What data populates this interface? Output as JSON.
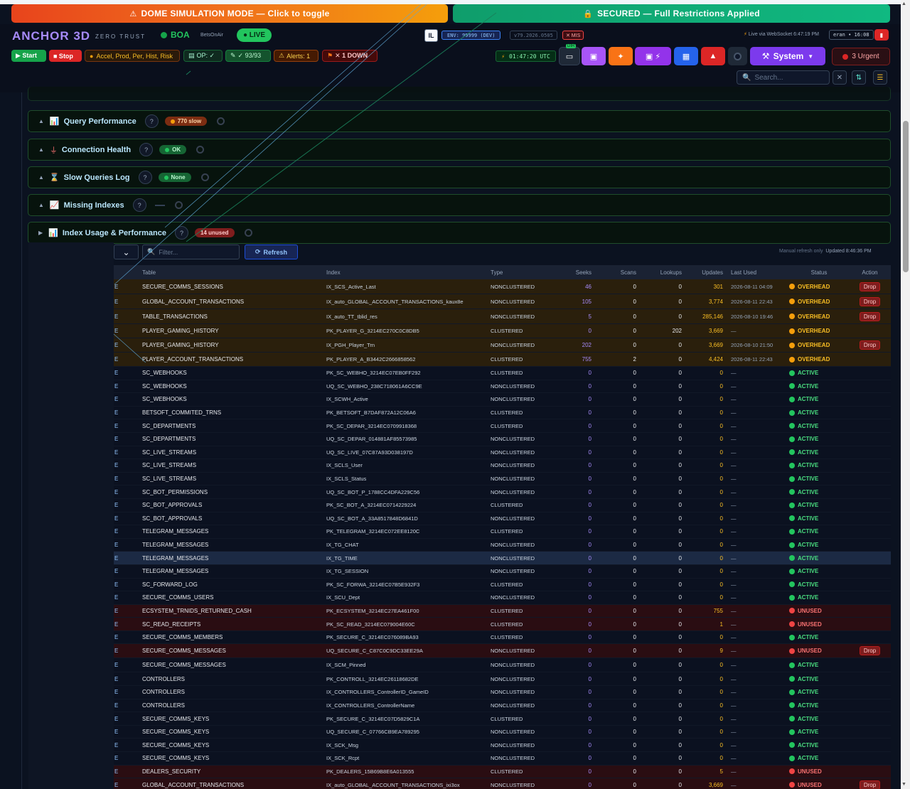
{
  "banners": {
    "simulation": "DOME SIMULATION MODE — Click to toggle",
    "secured": "SECURED — Full Restrictions Applied"
  },
  "header": {
    "brand": "ANCHOR 3D",
    "brand_sub": "ZERO TRUST",
    "boa": "BOA",
    "betsonair": "BetsOnAir",
    "live": "● LIVE",
    "il": "IL",
    "env": "ENV: 99999 (DEV)",
    "version": "v79.2026.0505",
    "mis": "✕ MIS",
    "live_ws": "Live via WebSocket 6:47:19 PM",
    "user": "eran • 16:08",
    "start": "▶ Start",
    "stop": "■ Stop",
    "accel": "Accel, Prod, Per, Hist, Risk",
    "op": "OP: ✓",
    "count": "✓ 93/93",
    "alerts": "Alerts: 1",
    "down": "✕ 1 DOWN",
    "clock": "01:47:20 UTC",
    "dir_label": "DIR",
    "system": "System",
    "urgent": "3 Urgent",
    "search_placeholder": "Search..."
  },
  "sections": [
    {
      "title": "Query Performance",
      "badge": "770 slow",
      "badge_type": "slow"
    },
    {
      "title": "Connection Health",
      "badge": "OK",
      "badge_type": "ok"
    },
    {
      "title": "Slow Queries Log",
      "badge": "None",
      "badge_type": "ok"
    },
    {
      "title": "Missing Indexes",
      "badge": "",
      "badge_type": "none"
    },
    {
      "title": "Index Usage & Performance",
      "badge": "14 unused",
      "badge_type": "unused"
    }
  ],
  "toolbar": {
    "filter_placeholder": "Filter...",
    "refresh": "Refresh",
    "note": "Manual refresh only",
    "updated": "Updated 8:46:36 PM"
  },
  "table": {
    "headers": [
      "Table",
      "Index",
      "Type",
      "Seeks",
      "Scans",
      "Lookups",
      "Updates",
      "Last Used",
      "Status",
      "Action"
    ],
    "drop_label": "Drop",
    "rows": [
      {
        "t": "SECURE_COMMS_SESSIONS",
        "i": "IX_SCS_Active_Last",
        "ty": "NONCLUSTERED",
        "sk": "46",
        "sc": "0",
        "lk": "0",
        "up": "301",
        "lu": "2026-08-11 04:09",
        "st": "OVERHEAD",
        "drop": true
      },
      {
        "t": "GLOBAL_ACCOUNT_TRANSACTIONS",
        "i": "IX_auto_GLOBAL_ACCOUNT_TRANSACTIONS_kaux8e",
        "ty": "NONCLUSTERED",
        "sk": "105",
        "sc": "0",
        "lk": "0",
        "up": "3,774",
        "lu": "2026-08-11 22:43",
        "st": "OVERHEAD",
        "drop": true
      },
      {
        "t": "TABLE_TRANSACTIONS",
        "i": "IX_auto_TT_tblid_res",
        "ty": "NONCLUSTERED",
        "sk": "5",
        "sc": "0",
        "lk": "0",
        "up": "285,146",
        "lu": "2026-08-10 19:46",
        "st": "OVERHEAD",
        "drop": true
      },
      {
        "t": "PLAYER_GAMING_HISTORY",
        "i": "PK_PLAYER_G_3214EC270C0C8DB5",
        "ty": "CLUSTERED",
        "sk": "0",
        "sc": "0",
        "lk": "202",
        "up": "3,669",
        "lu": "—",
        "st": "OVERHEAD",
        "drop": false
      },
      {
        "t": "PLAYER_GAMING_HISTORY",
        "i": "IX_PGH_Player_Trn",
        "ty": "NONCLUSTERED",
        "sk": "202",
        "sc": "0",
        "lk": "0",
        "up": "3,669",
        "lu": "2026-08-10 21:50",
        "st": "OVERHEAD",
        "drop": true
      },
      {
        "t": "PLAYER_ACCOUNT_TRANSACTIONS",
        "i": "PK_PLAYER_A_B3442C2666858562",
        "ty": "CLUSTERED",
        "sk": "755",
        "sc": "2",
        "lk": "0",
        "up": "4,424",
        "lu": "2026-08-11 22:43",
        "st": "OVERHEAD",
        "drop": false
      },
      {
        "t": "SC_WEBHOOKS",
        "i": "PK_SC_WEBHO_3214EC07EB0FF292",
        "ty": "CLUSTERED",
        "sk": "0",
        "sc": "0",
        "lk": "0",
        "up": "0",
        "lu": "—",
        "st": "ACTIVE",
        "drop": false
      },
      {
        "t": "SC_WEBHOOKS",
        "i": "UQ_SC_WEBHO_238C718061A6CC9E",
        "ty": "NONCLUSTERED",
        "sk": "0",
        "sc": "0",
        "lk": "0",
        "up": "0",
        "lu": "—",
        "st": "ACTIVE",
        "drop": false
      },
      {
        "t": "SC_WEBHOOKS",
        "i": "IX_SCWH_Active",
        "ty": "NONCLUSTERED",
        "sk": "0",
        "sc": "0",
        "lk": "0",
        "up": "0",
        "lu": "—",
        "st": "ACTIVE",
        "drop": false
      },
      {
        "t": "BETSOFT_COMMITED_TRNS",
        "i": "PK_BETSOFT_B7DAF872A12C06A6",
        "ty": "CLUSTERED",
        "sk": "0",
        "sc": "0",
        "lk": "0",
        "up": "0",
        "lu": "—",
        "st": "ACTIVE",
        "drop": false
      },
      {
        "t": "SC_DEPARTMENTS",
        "i": "PK_SC_DEPAR_3214EC0709918368",
        "ty": "CLUSTERED",
        "sk": "0",
        "sc": "0",
        "lk": "0",
        "up": "0",
        "lu": "—",
        "st": "ACTIVE",
        "drop": false
      },
      {
        "t": "SC_DEPARTMENTS",
        "i": "UQ_SC_DEPAR_014881AF85573985",
        "ty": "NONCLUSTERED",
        "sk": "0",
        "sc": "0",
        "lk": "0",
        "up": "0",
        "lu": "—",
        "st": "ACTIVE",
        "drop": false
      },
      {
        "t": "SC_LIVE_STREAMS",
        "i": "UQ_SC_LIVE_07C87A93D038197D",
        "ty": "NONCLUSTERED",
        "sk": "0",
        "sc": "0",
        "lk": "0",
        "up": "0",
        "lu": "—",
        "st": "ACTIVE",
        "drop": false
      },
      {
        "t": "SC_LIVE_STREAMS",
        "i": "IX_SCLS_User",
        "ty": "NONCLUSTERED",
        "sk": "0",
        "sc": "0",
        "lk": "0",
        "up": "0",
        "lu": "—",
        "st": "ACTIVE",
        "drop": false
      },
      {
        "t": "SC_LIVE_STREAMS",
        "i": "IX_SCLS_Status",
        "ty": "NONCLUSTERED",
        "sk": "0",
        "sc": "0",
        "lk": "0",
        "up": "0",
        "lu": "—",
        "st": "ACTIVE",
        "drop": false
      },
      {
        "t": "SC_BOT_PERMISSIONS",
        "i": "UQ_SC_BOT_P_1788CC4DFA229C56",
        "ty": "NONCLUSTERED",
        "sk": "0",
        "sc": "0",
        "lk": "0",
        "up": "0",
        "lu": "—",
        "st": "ACTIVE",
        "drop": false
      },
      {
        "t": "SC_BOT_APPROVALS",
        "i": "PK_SC_BOT_A_3214EC0714229224",
        "ty": "CLUSTERED",
        "sk": "0",
        "sc": "0",
        "lk": "0",
        "up": "0",
        "lu": "—",
        "st": "ACTIVE",
        "drop": false
      },
      {
        "t": "SC_BOT_APPROVALS",
        "i": "UQ_SC_BOT_A_33A8517848D6841D",
        "ty": "NONCLUSTERED",
        "sk": "0",
        "sc": "0",
        "lk": "0",
        "up": "0",
        "lu": "—",
        "st": "ACTIVE",
        "drop": false
      },
      {
        "t": "TELEGRAM_MESSAGES",
        "i": "PK_TELEGRAM_3214EC072EE8120C",
        "ty": "CLUSTERED",
        "sk": "0",
        "sc": "0",
        "lk": "0",
        "up": "0",
        "lu": "—",
        "st": "ACTIVE",
        "drop": false
      },
      {
        "t": "TELEGRAM_MESSAGES",
        "i": "IX_TG_CHAT",
        "ty": "NONCLUSTERED",
        "sk": "0",
        "sc": "0",
        "lk": "0",
        "up": "0",
        "lu": "—",
        "st": "ACTIVE",
        "drop": false
      },
      {
        "t": "TELEGRAM_MESSAGES",
        "i": "IX_TG_TIME",
        "ty": "NONCLUSTERED",
        "sk": "0",
        "sc": "0",
        "lk": "0",
        "up": "0",
        "lu": "—",
        "st": "ACTIVE",
        "drop": false,
        "hl": true
      },
      {
        "t": "TELEGRAM_MESSAGES",
        "i": "IX_TG_SESSION",
        "ty": "NONCLUSTERED",
        "sk": "0",
        "sc": "0",
        "lk": "0",
        "up": "0",
        "lu": "—",
        "st": "ACTIVE",
        "drop": false
      },
      {
        "t": "SC_FORWARD_LOG",
        "i": "PK_SC_FORWA_3214EC07B5E932F3",
        "ty": "CLUSTERED",
        "sk": "0",
        "sc": "0",
        "lk": "0",
        "up": "0",
        "lu": "—",
        "st": "ACTIVE",
        "drop": false
      },
      {
        "t": "SECURE_COMMS_USERS",
        "i": "IX_SCU_Dept",
        "ty": "NONCLUSTERED",
        "sk": "0",
        "sc": "0",
        "lk": "0",
        "up": "0",
        "lu": "—",
        "st": "ACTIVE",
        "drop": false
      },
      {
        "t": "ECSYSTEM_TRNIDS_RETURNED_CASH",
        "i": "PK_ECSYSTEM_3214EC27EA461F00",
        "ty": "CLUSTERED",
        "sk": "0",
        "sc": "0",
        "lk": "0",
        "up": "755",
        "lu": "—",
        "st": "UNUSED",
        "drop": false
      },
      {
        "t": "SC_READ_RECEIPTS",
        "i": "PK_SC_READ_3214EC079004E60C",
        "ty": "CLUSTERED",
        "sk": "0",
        "sc": "0",
        "lk": "0",
        "up": "1",
        "lu": "—",
        "st": "UNUSED",
        "drop": false
      },
      {
        "t": "SECURE_COMMS_MEMBERS",
        "i": "PK_SECURE_C_3214EC076089BA93",
        "ty": "CLUSTERED",
        "sk": "0",
        "sc": "0",
        "lk": "0",
        "up": "0",
        "lu": "—",
        "st": "ACTIVE",
        "drop": false
      },
      {
        "t": "SECURE_COMMS_MESSAGES",
        "i": "UQ_SECURE_C_C87C0C9DC33EE29A",
        "ty": "NONCLUSTERED",
        "sk": "0",
        "sc": "0",
        "lk": "0",
        "up": "9",
        "lu": "—",
        "st": "UNUSED",
        "drop": true
      },
      {
        "t": "SECURE_COMMS_MESSAGES",
        "i": "IX_SCM_Pinned",
        "ty": "NONCLUSTERED",
        "sk": "0",
        "sc": "0",
        "lk": "0",
        "up": "0",
        "lu": "—",
        "st": "ACTIVE",
        "drop": false
      },
      {
        "t": "CONTROLLERS",
        "i": "PK_CONTROLL_3214EC26118682DE",
        "ty": "NONCLUSTERED",
        "sk": "0",
        "sc": "0",
        "lk": "0",
        "up": "0",
        "lu": "—",
        "st": "ACTIVE",
        "drop": false
      },
      {
        "t": "CONTROLLERS",
        "i": "IX_CONTROLLERS_ControllerID_GameID",
        "ty": "NONCLUSTERED",
        "sk": "0",
        "sc": "0",
        "lk": "0",
        "up": "0",
        "lu": "—",
        "st": "ACTIVE",
        "drop": false
      },
      {
        "t": "CONTROLLERS",
        "i": "IX_CONTROLLERS_ControllerName",
        "ty": "NONCLUSTERED",
        "sk": "0",
        "sc": "0",
        "lk": "0",
        "up": "0",
        "lu": "—",
        "st": "ACTIVE",
        "drop": false
      },
      {
        "t": "SECURE_COMMS_KEYS",
        "i": "PK_SECURE_C_3214EC07D5829C1A",
        "ty": "CLUSTERED",
        "sk": "0",
        "sc": "0",
        "lk": "0",
        "up": "0",
        "lu": "—",
        "st": "ACTIVE",
        "drop": false
      },
      {
        "t": "SECURE_COMMS_KEYS",
        "i": "UQ_SECURE_C_07766CB9EA789295",
        "ty": "NONCLUSTERED",
        "sk": "0",
        "sc": "0",
        "lk": "0",
        "up": "0",
        "lu": "—",
        "st": "ACTIVE",
        "drop": false
      },
      {
        "t": "SECURE_COMMS_KEYS",
        "i": "IX_SCK_Msg",
        "ty": "NONCLUSTERED",
        "sk": "0",
        "sc": "0",
        "lk": "0",
        "up": "0",
        "lu": "—",
        "st": "ACTIVE",
        "drop": false
      },
      {
        "t": "SECURE_COMMS_KEYS",
        "i": "IX_SCK_Rcpt",
        "ty": "NONCLUSTERED",
        "sk": "0",
        "sc": "0",
        "lk": "0",
        "up": "0",
        "lu": "—",
        "st": "ACTIVE",
        "drop": false
      },
      {
        "t": "DEALERS_SECURITY",
        "i": "PK_DEALERS_15B69B8E6A013555",
        "ty": "CLUSTERED",
        "sk": "0",
        "sc": "0",
        "lk": "0",
        "up": "5",
        "lu": "—",
        "st": "UNUSED",
        "drop": false
      },
      {
        "t": "GLOBAL_ACCOUNT_TRANSACTIONS",
        "i": "IX_auto_GLOBAL_ACCOUNT_TRANSACTIONS_ixi3ox",
        "ty": "NONCLUSTERED",
        "sk": "0",
        "sc": "0",
        "lk": "0",
        "up": "3,669",
        "lu": "—",
        "st": "UNUSED",
        "drop": true
      }
    ]
  },
  "colors": {
    "overhead": "#fbbf24",
    "active": "#4ade80",
    "unused": "#f87171",
    "accent": "#7c3aed"
  }
}
